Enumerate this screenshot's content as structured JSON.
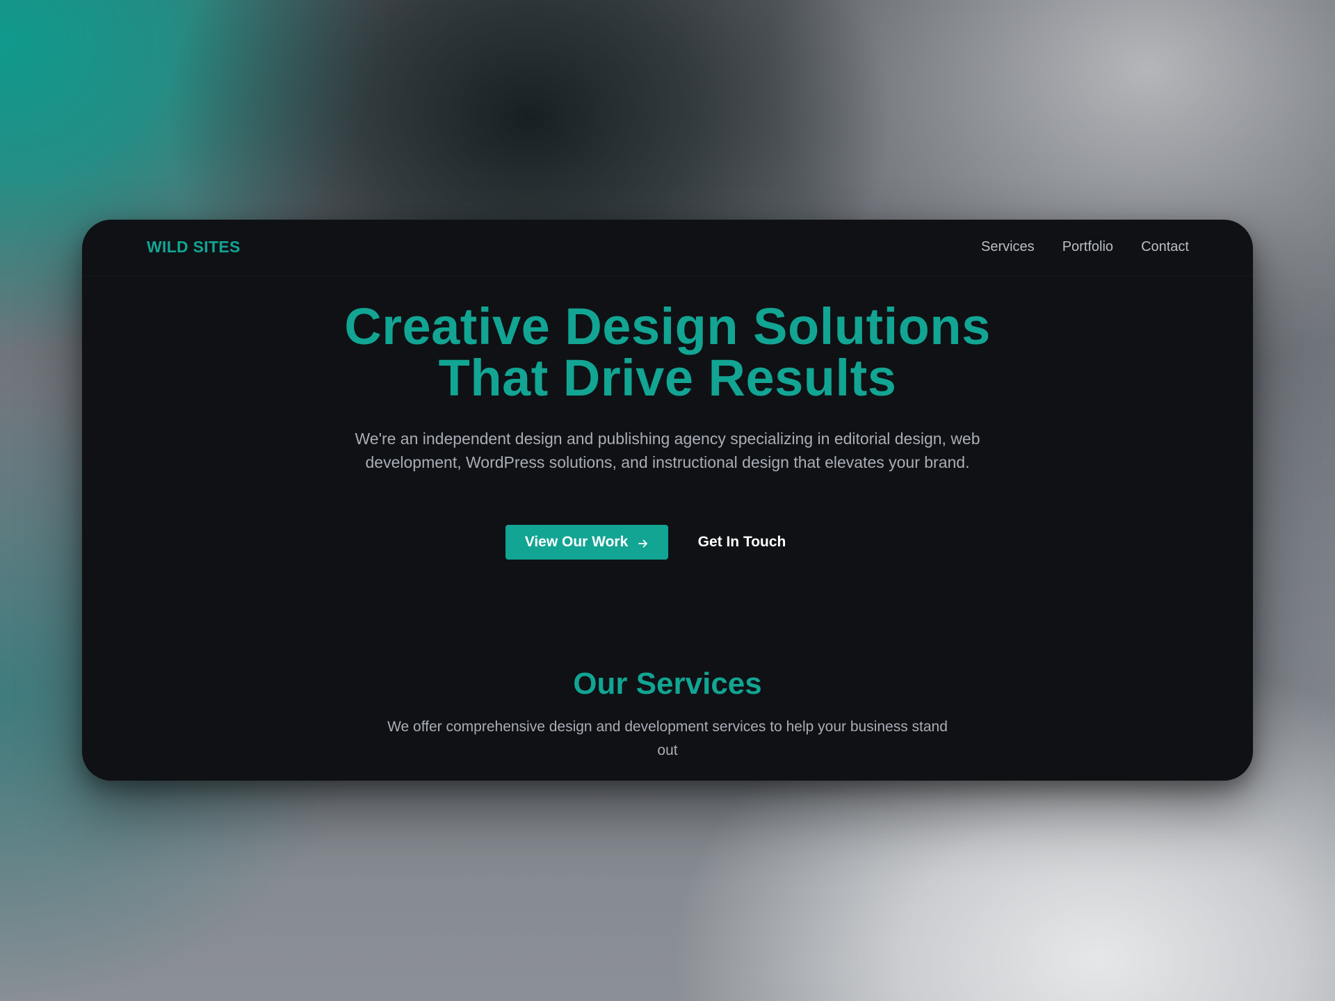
{
  "brand": {
    "logo": "WILD SITES",
    "accent_color": "#12a593",
    "background_color": "#0f1115"
  },
  "nav": {
    "items": [
      {
        "label": "Services"
      },
      {
        "label": "Portfolio"
      },
      {
        "label": "Contact"
      }
    ]
  },
  "hero": {
    "title_line1": "Creative Design Solutions",
    "title_line2": "That Drive Results",
    "description": "We're an independent design and publishing agency specializing in editorial design, web development, WordPress solutions, and instructional design that elevates your brand.",
    "primary_button": {
      "label": "View Our Work",
      "icon": "arrow-right-icon"
    },
    "secondary_button": {
      "label": "Get In Touch"
    }
  },
  "services": {
    "title": "Our Services",
    "description": "We offer comprehensive design and development services to help your business stand out"
  }
}
